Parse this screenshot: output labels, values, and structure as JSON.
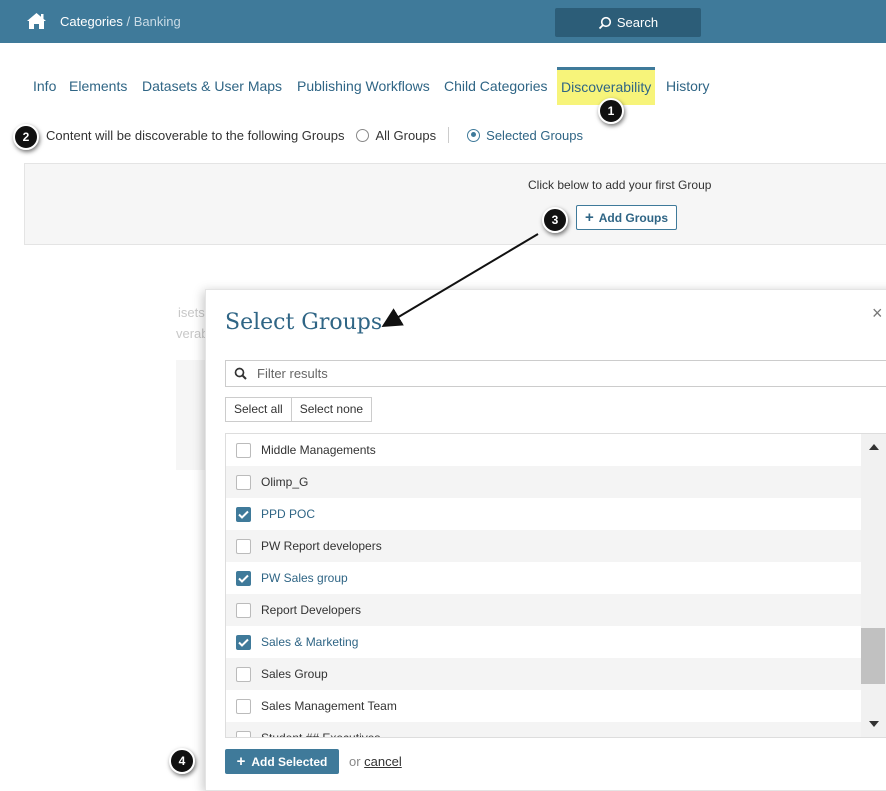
{
  "header": {
    "breadcrumb_root": "Categories",
    "breadcrumb_sep": " / ",
    "breadcrumb_current": "Banking",
    "search_label": "Search"
  },
  "tabs": [
    {
      "label": "Info"
    },
    {
      "label": "Elements"
    },
    {
      "label": "Datasets & User Maps"
    },
    {
      "label": "Publishing Workflows"
    },
    {
      "label": "Child Categories"
    },
    {
      "label": "Discoverability",
      "active": true
    },
    {
      "label": "History"
    }
  ],
  "discoverability": {
    "intro": "Content will be discoverable to the following Groups",
    "option_all": "All Groups",
    "option_selected": "Selected Groups",
    "selected_option": "Selected Groups",
    "empty_message": "Click below to add your first Group",
    "add_groups_label": "Add Groups"
  },
  "background_ghost": {
    "text1": "isets",
    "text2": "verab"
  },
  "callouts": [
    "1",
    "2",
    "3",
    "4"
  ],
  "modal": {
    "title": "Select Groups",
    "close_glyph": "×",
    "filter_placeholder": "Filter results",
    "select_all": "Select all",
    "select_none": "Select none",
    "groups": [
      {
        "name": "Middle Managements",
        "checked": false
      },
      {
        "name": "Olimp_G",
        "checked": false
      },
      {
        "name": "PPD POC",
        "checked": true
      },
      {
        "name": "PW Report developers",
        "checked": false
      },
      {
        "name": "PW Sales group",
        "checked": true
      },
      {
        "name": "Report Developers",
        "checked": false
      },
      {
        "name": "Sales & Marketing",
        "checked": true
      },
      {
        "name": "Sales Group",
        "checked": false
      },
      {
        "name": "Sales Management Team",
        "checked": false
      },
      {
        "name": "Student ## Executives",
        "checked": false
      }
    ],
    "add_selected_label": "Add Selected",
    "or_text": "or ",
    "cancel_label": "cancel"
  },
  "colors": {
    "brand": "#3f7a9a",
    "highlight": "#f7f47a",
    "link": "#2f6585"
  }
}
